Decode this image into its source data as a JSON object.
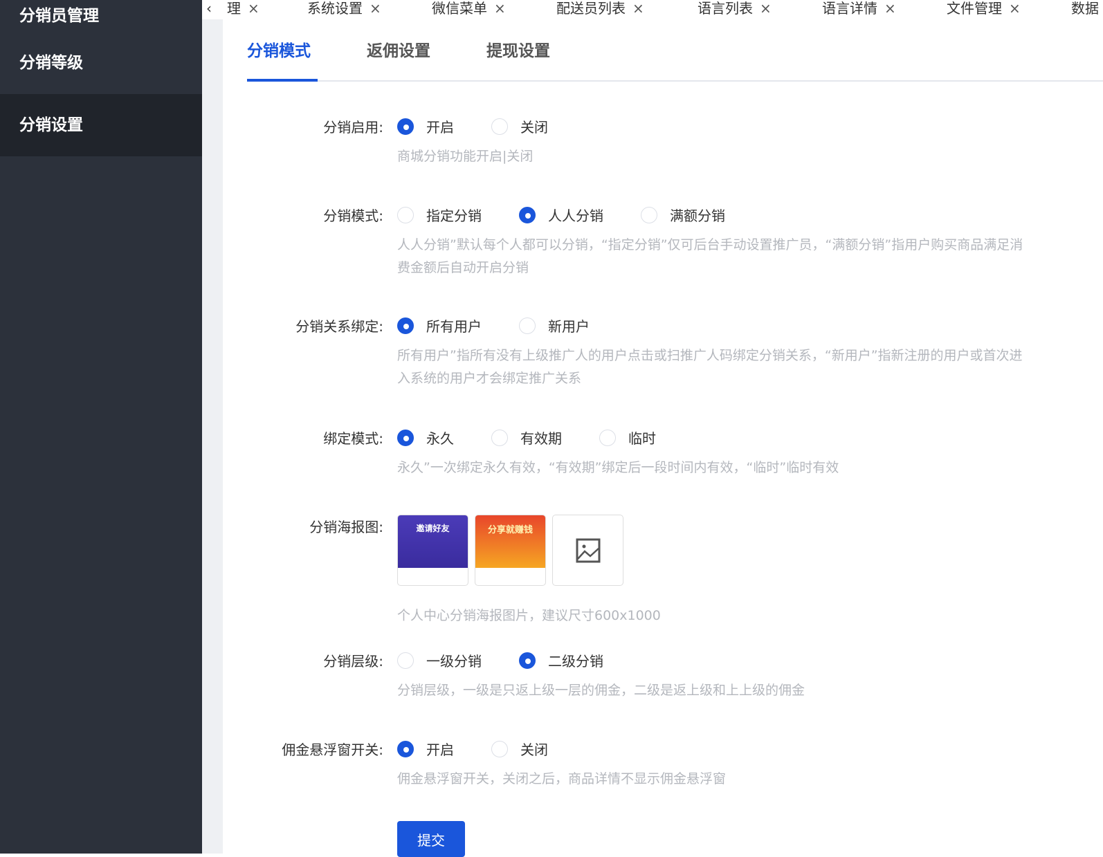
{
  "sidebar": {
    "items": [
      {
        "label": "分销员管理"
      },
      {
        "label": "分销等级"
      },
      {
        "label": "分销设置"
      }
    ]
  },
  "tags": [
    {
      "label": "理"
    },
    {
      "label": "系统设置"
    },
    {
      "label": "微信菜单"
    },
    {
      "label": "配送员列表"
    },
    {
      "label": "语言列表"
    },
    {
      "label": "语言详情"
    },
    {
      "label": "文件管理"
    },
    {
      "label": "数据"
    }
  ],
  "tabs": [
    {
      "label": "分销模式"
    },
    {
      "label": "返佣设置"
    },
    {
      "label": "提现设置"
    }
  ],
  "form": {
    "enable": {
      "label": "分销启用:",
      "options": [
        "开启",
        "关闭"
      ],
      "selected": "开启",
      "hint": "商城分销功能开启|关闭"
    },
    "mode": {
      "label": "分销模式:",
      "options": [
        "指定分销",
        "人人分销",
        "满额分销"
      ],
      "selected": "人人分销",
      "hint1": "人人分销”默认每个人都可以分销，“指定分销”仅可后台手动设置推广员，“满额分销”指用户购买商品满足消",
      "hint2": "费金额后自动开启分销"
    },
    "binding": {
      "label": "分销关系绑定:",
      "options": [
        "所有用户",
        "新用户"
      ],
      "selected": "所有用户",
      "hint1": "所有用户”指所有没有上级推广人的用户点击或扫推广人码绑定分销关系，“新用户”指新注册的用户或首次进",
      "hint2": "入系统的用户才会绑定推广关系"
    },
    "bind_mode": {
      "label": "绑定模式:",
      "options": [
        "永久",
        "有效期",
        "临时"
      ],
      "selected": "永久",
      "hint": "永久”一次绑定永久有效，“有效期”绑定后一段时间内有效，“临时”临时有效"
    },
    "poster": {
      "label": "分销海报图:",
      "poster1_text": "邀请好友",
      "poster2_text": "分享就赚钱",
      "hint": "个人中心分销海报图片，建议尺寸600x1000"
    },
    "level": {
      "label": "分销层级:",
      "options": [
        "一级分销",
        "二级分销"
      ],
      "selected": "二级分销",
      "hint": "分销层级，一级是只返上级一层的佣金，二级是返上级和上上级的佣金"
    },
    "float": {
      "label": "佣金悬浮窗开关:",
      "options": [
        "开启",
        "关闭"
      ],
      "selected": "开启",
      "hint": "佣金悬浮窗开关，关闭之后，商品详情不显示佣金悬浮窗"
    },
    "submit_label": "提交"
  }
}
